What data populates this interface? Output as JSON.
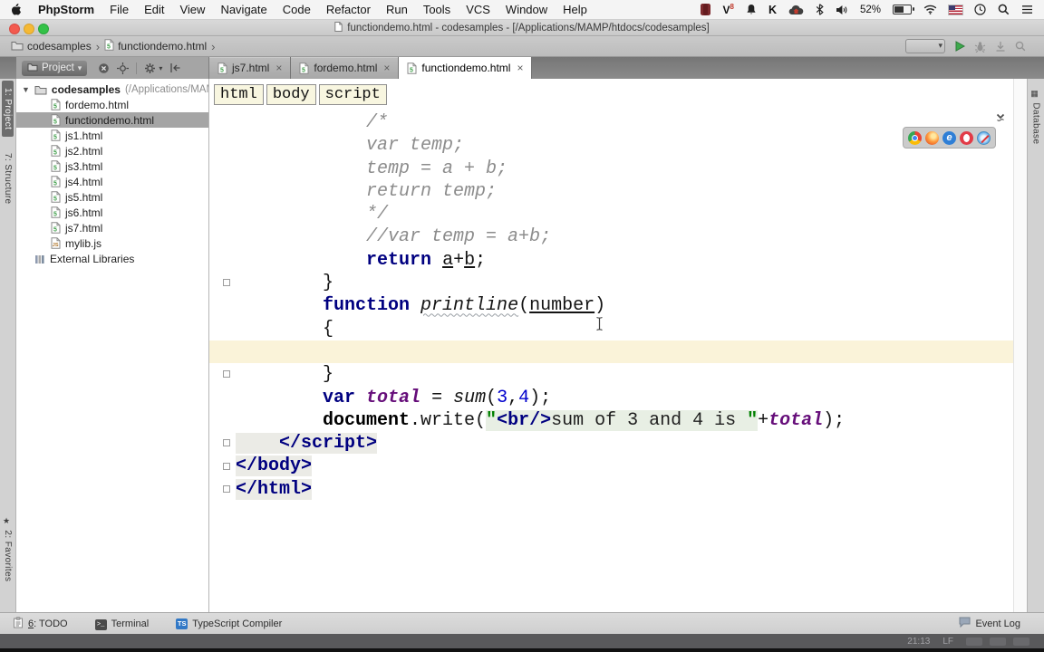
{
  "menubar": {
    "items": [
      {
        "label": "PhpStorm",
        "bold": true
      },
      {
        "label": "File"
      },
      {
        "label": "Edit"
      },
      {
        "label": "View"
      },
      {
        "label": "Navigate"
      },
      {
        "label": "Code"
      },
      {
        "label": "Refactor"
      },
      {
        "label": "Run"
      },
      {
        "label": "Tools"
      },
      {
        "label": "VCS"
      },
      {
        "label": "Window"
      },
      {
        "label": "Help"
      }
    ],
    "status_items": [
      {
        "name": "screen-recorder-icon"
      },
      {
        "name": "v8-icon"
      },
      {
        "name": "bell-icon"
      },
      {
        "name": "k-app-icon"
      },
      {
        "name": "cloud-home-icon"
      },
      {
        "name": "bluetooth-icon"
      },
      {
        "name": "volume-icon"
      },
      {
        "name": "battery-percentage",
        "text": "52%"
      },
      {
        "name": "battery-icon"
      },
      {
        "name": "wifi-icon"
      },
      {
        "name": "keyboard-flag-icon"
      },
      {
        "name": "clock-icon"
      },
      {
        "name": "spotlight-icon"
      },
      {
        "name": "notification-center-icon"
      }
    ]
  },
  "window": {
    "title": "functiondemo.html - codesamples - [/Applications/MAMP/htdocs/codesamples]"
  },
  "navbar": {
    "breadcrumbs": [
      {
        "label": "codesamples",
        "icon": "folder-icon"
      },
      {
        "label": "functiondemo.html",
        "icon": "html-file-icon"
      }
    ]
  },
  "tabs": [
    {
      "label": "js7.html"
    },
    {
      "label": "fordemo.html"
    },
    {
      "label": "functiondemo.html",
      "active": true
    }
  ],
  "project_panel": {
    "header": {
      "combo_label": "Project"
    },
    "tree": {
      "root_label": "codesamples",
      "root_suffix": " (/Applications/MAM",
      "items": [
        {
          "label": "fordemo.html",
          "icon": "html-file-icon"
        },
        {
          "label": "functiondemo.html",
          "icon": "html-file-icon",
          "selected": true
        },
        {
          "label": "js1.html",
          "icon": "html-file-icon"
        },
        {
          "label": "js2.html",
          "icon": "html-file-icon"
        },
        {
          "label": "js3.html",
          "icon": "html-file-icon"
        },
        {
          "label": "js4.html",
          "icon": "html-file-icon"
        },
        {
          "label": "js5.html",
          "icon": "html-file-icon"
        },
        {
          "label": "js6.html",
          "icon": "html-file-icon"
        },
        {
          "label": "js7.html",
          "icon": "html-file-icon"
        },
        {
          "label": "mylib.js",
          "icon": "js-file-icon"
        },
        {
          "label": "External Libraries",
          "icon": "lib-icon",
          "style": "extlib"
        }
      ]
    }
  },
  "editor": {
    "breadcrumbs": [
      "html",
      "body",
      "script"
    ],
    "browser_icons": [
      "chrome-icon",
      "firefox-icon",
      "ie-icon",
      "opera-icon",
      "safari-icon"
    ],
    "code_lines": [
      {
        "i": 3,
        "s": [
          [
            "cmt",
            "/*"
          ]
        ]
      },
      {
        "i": 3,
        "s": [
          [
            "cmt",
            "var temp;"
          ]
        ]
      },
      {
        "i": 3,
        "s": [
          [
            "cmt",
            "temp = a + b;"
          ]
        ]
      },
      {
        "i": 3,
        "s": [
          [
            "cmt",
            "return temp;"
          ]
        ]
      },
      {
        "i": 3,
        "s": [
          [
            "cmt",
            "*/"
          ]
        ]
      },
      {
        "i": 3,
        "s": [
          [
            "cmt",
            "//var temp = a+b;"
          ]
        ]
      },
      {
        "i": 3,
        "s": [
          [
            "kw",
            "return"
          ],
          [
            "plain",
            " "
          ],
          [
            "und",
            "a"
          ],
          [
            "plain",
            "+"
          ],
          [
            "und",
            "b"
          ],
          [
            "plain",
            ";"
          ]
        ]
      },
      {
        "i": 2,
        "fold": true,
        "s": [
          [
            "plain",
            "}"
          ]
        ]
      },
      {
        "i": 2,
        "s": [
          [
            "kw",
            "function"
          ],
          [
            "plain",
            " "
          ],
          [
            "fnw",
            "printline"
          ],
          [
            "plain",
            "("
          ],
          [
            "und",
            "number"
          ],
          [
            "plain",
            ")"
          ]
        ]
      },
      {
        "i": 2,
        "s": [
          [
            "plain",
            "{"
          ]
        ]
      },
      {
        "i": 0,
        "caret": true,
        "s": []
      },
      {
        "i": 2,
        "fold": true,
        "s": [
          [
            "plain",
            "}"
          ]
        ]
      },
      {
        "i": 2,
        "s": [
          [
            "kw",
            "var"
          ],
          [
            "plain",
            " "
          ],
          [
            "var",
            "total"
          ],
          [
            "plain",
            " = "
          ],
          [
            "fn",
            "sum"
          ],
          [
            "plain",
            "("
          ],
          [
            "num",
            "3"
          ],
          [
            "plain",
            ","
          ],
          [
            "num",
            "4"
          ],
          [
            "plain",
            ");"
          ]
        ]
      },
      {
        "i": 2,
        "s": [
          [
            "doc",
            "document"
          ],
          [
            "plain",
            ".write("
          ],
          [
            "str",
            "\""
          ],
          [
            "stag",
            "<br/>"
          ],
          [
            "sbody",
            "sum of 3 and 4 is "
          ],
          [
            "str",
            "\""
          ],
          [
            "plain",
            "+"
          ],
          [
            "var",
            "total"
          ],
          [
            "plain",
            ");"
          ]
        ]
      },
      {
        "i": 1,
        "fold": true,
        "patch": true,
        "s": [
          [
            "tag",
            "</script>"
          ]
        ]
      },
      {
        "i": 0,
        "fold": true,
        "patch": true,
        "s": [
          [
            "tag",
            "</body>"
          ]
        ]
      },
      {
        "i": 0,
        "fold": true,
        "patch": true,
        "s": [
          [
            "tag",
            "</html>"
          ]
        ]
      }
    ]
  },
  "stripes": {
    "left": [
      {
        "label": "1: Project",
        "pressed": true
      },
      {
        "label": "7: Structure"
      },
      {
        "label": "2: Favorites",
        "icon": "star-icon",
        "bottom": true
      }
    ],
    "right": [
      {
        "label": "Database",
        "icon": "grid-icon"
      }
    ]
  },
  "bottom_bar": {
    "items": [
      {
        "label": "6: TODO",
        "icon": "todo-icon",
        "mnemonic": true
      },
      {
        "label": "Terminal",
        "icon": "terminal-icon"
      },
      {
        "label": "TypeScript Compiler",
        "icon": "typescript-icon"
      }
    ],
    "event_log": "Event Log"
  },
  "status_strip": {
    "position": "21:13",
    "line_ending": "LF"
  },
  "colors": {
    "keyword": "#000080",
    "string": "#008000",
    "comment": "#8c8c8c",
    "variable": "#660e7a",
    "caret_line": "#faf3d9",
    "selection": "#a5a5a5",
    "run_green": "#3da94c"
  }
}
